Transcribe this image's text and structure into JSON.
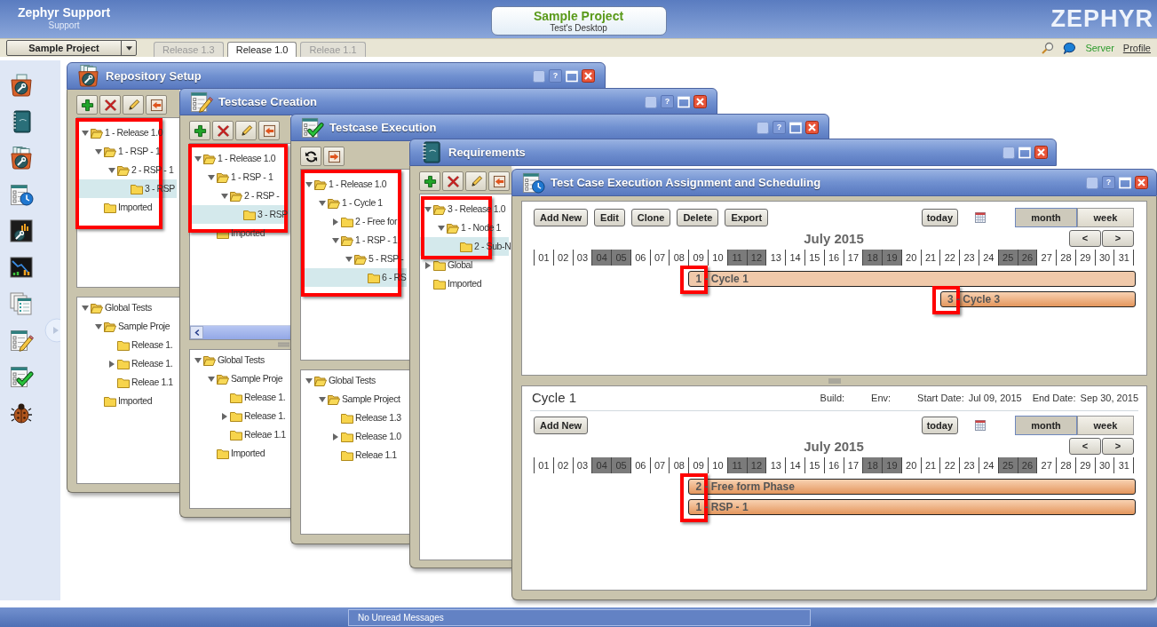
{
  "header": {
    "app_title": "Zephyr Support",
    "app_subtitle": "Support",
    "project": "Sample Project",
    "desktop": "Test's Desktop",
    "logo": "ZEPHYR"
  },
  "nav": {
    "project_select": "Sample Project",
    "release_tabs": [
      {
        "label": "Release 1.3",
        "selected": false
      },
      {
        "label": "Release 1.0",
        "selected": true
      },
      {
        "label": "Releae 1.1",
        "selected": false
      }
    ],
    "server_status": "Server",
    "profile": "Profile"
  },
  "sidebar": [
    {
      "kind": "box_wrench"
    },
    {
      "kind": "book"
    },
    {
      "kind": "box_papers_wrench"
    },
    {
      "kind": "checklist_clock"
    },
    {
      "kind": "panel_wrench"
    },
    {
      "kind": "chart"
    },
    {
      "kind": "documents"
    },
    {
      "kind": "checklist_pencil"
    },
    {
      "kind": "checklist_check"
    },
    {
      "kind": "bug"
    }
  ],
  "windows": [
    {
      "kind": "box_papers_wrench",
      "title": "Repository Setup",
      "help_button": "?",
      "toolbar": [
        {
          "kind": "add"
        },
        {
          "kind": "delete"
        },
        {
          "kind": "edit"
        },
        {
          "kind": "import"
        }
      ],
      "tree_highlighted": true,
      "tree": [
        {
          "label": "1 - Release 1.0",
          "expanded": true,
          "selected": false,
          "children": [
            {
              "label": "1 - RSP - 1",
              "expanded": true,
              "selected": false,
              "children": [
                {
                  "label": "2 - RSP - 1",
                  "expanded": true,
                  "selected": false,
                  "children": [
                    {
                      "label": "3 - RSP",
                      "selected": true
                    }
                  ]
                }
              ]
            },
            {
              "label": "Imported",
              "selected": false
            }
          ]
        }
      ],
      "global_tree": [
        {
          "label": "Global Tests",
          "expanded": true,
          "selected": false,
          "children": [
            {
              "label": "Sample Proje",
              "expanded": true,
              "selected": false,
              "children": [
                {
                  "label": "Release 1.",
                  "selected": false
                },
                {
                  "label": "Release 1.",
                  "expanded": false,
                  "selected": false
                },
                {
                  "label": "Releae 1.1",
                  "selected": false
                }
              ]
            },
            {
              "label": "Imported",
              "selected": false
            }
          ]
        }
      ]
    },
    {
      "kind": "checklist_pencil",
      "title": "Testcase Creation",
      "help_button": "?",
      "toolbar": [
        {
          "kind": "add"
        },
        {
          "kind": "delete"
        },
        {
          "kind": "edit"
        },
        {
          "kind": "import"
        }
      ],
      "tree_highlighted": true,
      "scrollbar": true,
      "tree": [
        {
          "label": "1 - Release 1.0",
          "expanded": true,
          "selected": false,
          "children": [
            {
              "label": "1 - RSP - 1",
              "expanded": true,
              "selected": false,
              "children": [
                {
                  "label": "2 - RSP -",
                  "expanded": true,
                  "selected": false,
                  "children": [
                    {
                      "label": "3 - RSP",
                      "selected": true
                    }
                  ]
                }
              ]
            },
            {
              "label": "Imported",
              "selected": false
            }
          ]
        }
      ],
      "global_tree": [
        {
          "label": "Global Tests",
          "expanded": true,
          "selected": false,
          "children": [
            {
              "label": "Sample Proje",
              "expanded": true,
              "selected": false,
              "children": [
                {
                  "label": "Release 1.",
                  "selected": false
                },
                {
                  "label": "Release 1.",
                  "expanded": false,
                  "selected": false
                },
                {
                  "label": "Releae 1.1",
                  "selected": false
                }
              ]
            },
            {
              "label": "Imported",
              "selected": false
            }
          ]
        }
      ]
    },
    {
      "kind": "checklist_check",
      "title": "Testcase Execution",
      "help_button": "?",
      "toolbar": [
        {
          "kind": "refresh"
        },
        {
          "kind": "export"
        }
      ],
      "tree_highlighted": true,
      "tree": [
        {
          "label": "1 - Release 1.0",
          "expanded": true,
          "selected": false,
          "children": [
            {
              "label": "1 - Cycle 1",
              "expanded": true,
              "selected": false,
              "children": [
                {
                  "label": "2 - Free for",
                  "expanded": false,
                  "selected": false
                },
                {
                  "label": "1 - RSP - 1",
                  "expanded": true,
                  "selected": false,
                  "children": [
                    {
                      "label": "5 - RSP -",
                      "expanded": true,
                      "selected": false,
                      "children": [
                        {
                          "label": "6 - RS",
                          "selected": true
                        }
                      ]
                    }
                  ]
                }
              ]
            }
          ]
        }
      ],
      "global_tree": [
        {
          "label": "Global Tests",
          "expanded": true,
          "selected": false,
          "children": [
            {
              "label": "Sample Project",
              "expanded": true,
              "selected": false,
              "children": [
                {
                  "label": "Release 1.3",
                  "selected": false
                },
                {
                  "label": "Release 1.0",
                  "expanded": false,
                  "selected": false
                },
                {
                  "label": "Releae 1.1",
                  "selected": false
                }
              ]
            }
          ]
        }
      ]
    },
    {
      "kind": "book",
      "title": "Requirements",
      "toolbar": [
        {
          "kind": "add"
        },
        {
          "kind": "delete"
        },
        {
          "kind": "edit"
        },
        {
          "kind": "import"
        }
      ],
      "tree_highlighted": true,
      "tree": [
        {
          "label": "3 - Release 1.0",
          "expanded": true,
          "selected": false,
          "children": [
            {
              "label": "1 - Node 1",
              "expanded": true,
              "selected": false,
              "children": [
                {
                  "label": "2 - Sub-N",
                  "selected": true
                }
              ]
            }
          ]
        },
        {
          "label": "Global",
          "expanded": false,
          "selected": false
        },
        {
          "label": "Imported",
          "selected": false
        }
      ]
    },
    {
      "kind": "checklist_clock",
      "title": "Test Case Execution Assignment and Scheduling",
      "help_button": "?",
      "calendar": {
        "buttons": [
          "Add New",
          "Edit",
          "Clone",
          "Delete",
          "Export"
        ],
        "today": "today",
        "views": [
          {
            "label": "month",
            "selected": true
          },
          {
            "label": "week",
            "selected": false
          }
        ],
        "month": "July 2015",
        "prev": "<",
        "next": ">",
        "days": [
          {
            "label": "01",
            "weekend": false
          },
          {
            "label": "02",
            "weekend": false
          },
          {
            "label": "03",
            "weekend": false
          },
          {
            "label": "04",
            "weekend": true
          },
          {
            "label": "05",
            "weekend": true
          },
          {
            "label": "06",
            "weekend": false
          },
          {
            "label": "07",
            "weekend": false
          },
          {
            "label": "08",
            "weekend": false
          },
          {
            "label": "09",
            "weekend": false,
            "events": [
              {
                "label": "1 - Cycle 1",
                "selected": true,
                "highlighted": true
              }
            ]
          },
          {
            "label": "10",
            "weekend": false
          },
          {
            "label": "11",
            "weekend": true
          },
          {
            "label": "12",
            "weekend": true
          },
          {
            "label": "13",
            "weekend": false
          },
          {
            "label": "14",
            "weekend": false
          },
          {
            "label": "15",
            "weekend": false
          },
          {
            "label": "16",
            "weekend": false
          },
          {
            "label": "17",
            "weekend": false
          },
          {
            "label": "18",
            "weekend": true
          },
          {
            "label": "19",
            "weekend": true
          },
          {
            "label": "20",
            "weekend": false
          },
          {
            "label": "21",
            "weekend": false
          },
          {
            "label": "22",
            "weekend": false,
            "events": [
              {
                "label": "3 - Cycle 3",
                "selected": false,
                "highlighted": true
              }
            ]
          },
          {
            "label": "23",
            "weekend": false
          },
          {
            "label": "24",
            "weekend": false
          },
          {
            "label": "25",
            "weekend": true
          },
          {
            "label": "26",
            "weekend": true
          },
          {
            "label": "27",
            "weekend": false
          },
          {
            "label": "28",
            "weekend": false
          },
          {
            "label": "29",
            "weekend": false
          },
          {
            "label": "30",
            "weekend": false
          },
          {
            "label": "31",
            "weekend": false
          }
        ]
      },
      "cycle": {
        "title": "Cycle 1",
        "fields": [
          {
            "label": "Build:"
          },
          {
            "label": "Env:"
          },
          {
            "label": "Start Date:",
            "value": "Jul 09, 2015"
          },
          {
            "label": "End Date:",
            "value": "Sep 30, 2015"
          }
        ],
        "calendar": {
          "buttons": [
            "Add New"
          ],
          "today": "today",
          "views": [
            {
              "label": "month",
              "selected": true
            },
            {
              "label": "week",
              "selected": false
            }
          ],
          "month": "July 2015",
          "prev": "<",
          "next": ">",
          "days": [
            {
              "label": "01",
              "weekend": false
            },
            {
              "label": "02",
              "weekend": false
            },
            {
              "label": "03",
              "weekend": false
            },
            {
              "label": "04",
              "weekend": true
            },
            {
              "label": "05",
              "weekend": true
            },
            {
              "label": "06",
              "weekend": false
            },
            {
              "label": "07",
              "weekend": false
            },
            {
              "label": "08",
              "weekend": false
            },
            {
              "label": "09",
              "weekend": false,
              "events": [
                {
                  "label": "2 - Free form Phase",
                  "selected": false,
                  "highlighted": true
                },
                {
                  "label": "1 - RSP - 1",
                  "selected": false,
                  "highlighted": true
                }
              ]
            },
            {
              "label": "10",
              "weekend": false
            },
            {
              "label": "11",
              "weekend": true
            },
            {
              "label": "12",
              "weekend": true
            },
            {
              "label": "13",
              "weekend": false
            },
            {
              "label": "14",
              "weekend": false
            },
            {
              "label": "15",
              "weekend": false
            },
            {
              "label": "16",
              "weekend": false
            },
            {
              "label": "17",
              "weekend": false
            },
            {
              "label": "18",
              "weekend": true
            },
            {
              "label": "19",
              "weekend": true
            },
            {
              "label": "20",
              "weekend": false
            },
            {
              "label": "21",
              "weekend": false
            },
            {
              "label": "22",
              "weekend": false
            },
            {
              "label": "23",
              "weekend": false
            },
            {
              "label": "24",
              "weekend": false
            },
            {
              "label": "25",
              "weekend": true
            },
            {
              "label": "26",
              "weekend": true
            },
            {
              "label": "27",
              "weekend": false
            },
            {
              "label": "28",
              "weekend": false
            },
            {
              "label": "29",
              "weekend": false
            },
            {
              "label": "30",
              "weekend": false
            },
            {
              "label": "31",
              "weekend": false
            }
          ]
        }
      }
    }
  ],
  "footer": {
    "messages": "No Unread Messages"
  }
}
